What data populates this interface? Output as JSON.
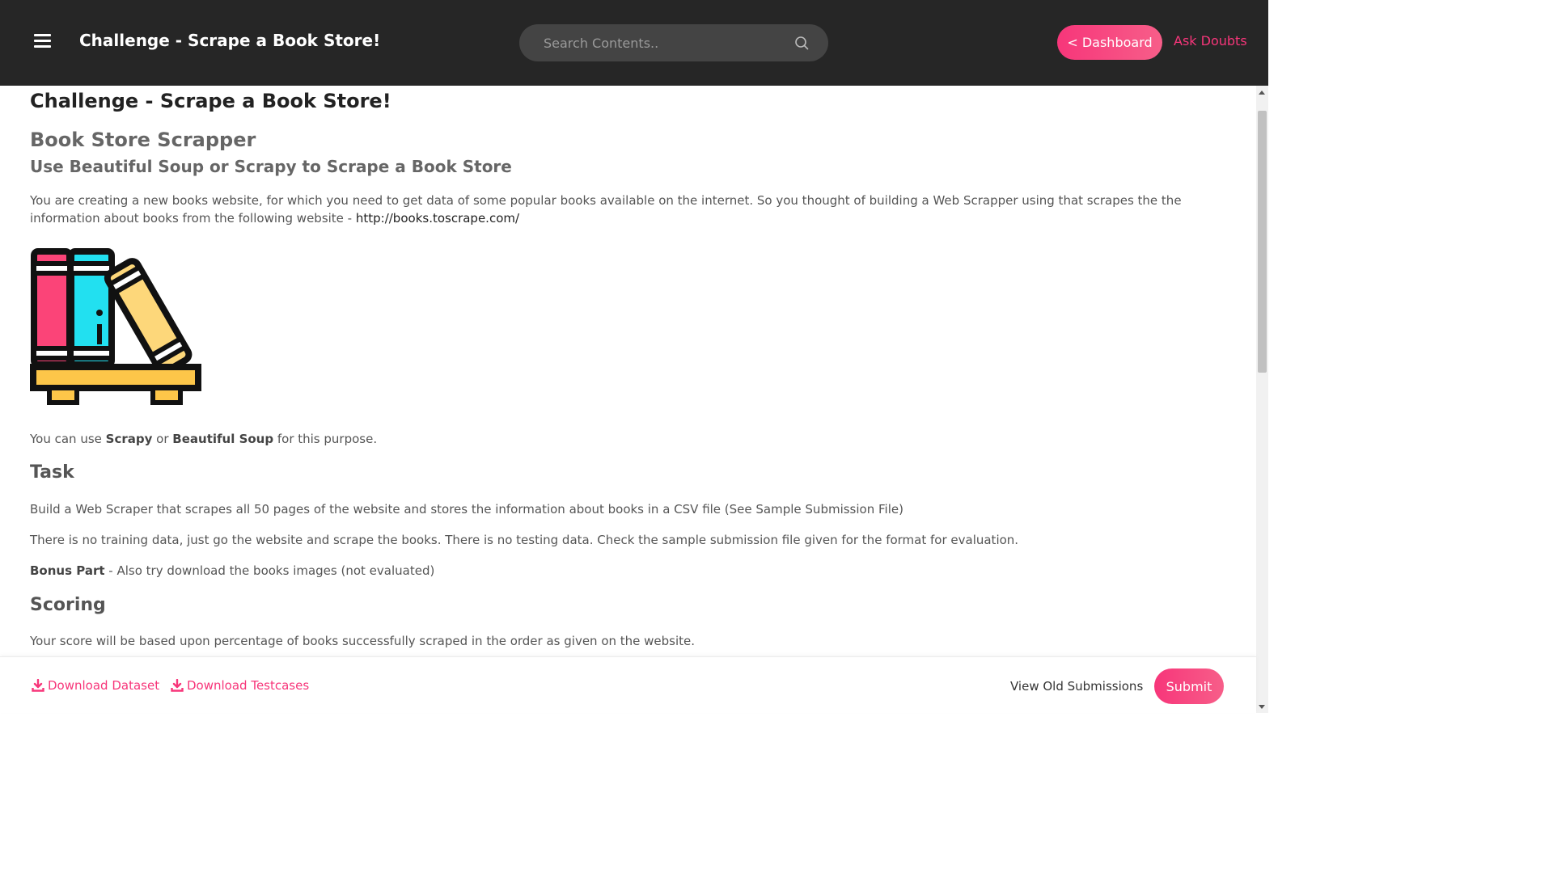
{
  "header": {
    "title": "Challenge - Scrape a Book Store!",
    "search_placeholder": "Search Contents..",
    "dashboard_label": "< Dashboard",
    "ask_doubts_label": "Ask Doubts"
  },
  "content": {
    "page_title": "Challenge - Scrape a Book Store!",
    "heading": "Book Store Scrapper",
    "subheading": "Use Beautiful Soup or Scrapy to Scrape a Book Store",
    "intro_text": "You are creating a new books website, for which you need to get data of some popular books available on the internet. So you thought of building a Web Scrapper using that scrapes the the information about books from the following website - ",
    "intro_link": "http://books.toscrape.com/",
    "tools_prefix": "You can use ",
    "tools_scrapy": "Scrapy",
    "tools_or": " or ",
    "tools_bs": "Beautiful Soup",
    "tools_suffix": " for this purpose.",
    "task_heading": "Task",
    "task_text_1": "Build a Web Scraper that scrapes all 50 pages of the website and stores the information about books in a CSV file (See Sample Submission File)",
    "task_text_2": "There is no training data, just go the website and scrape the books. There is no testing data. Check the sample submission file given for the format for evaluation.",
    "bonus_label": "Bonus Part",
    "bonus_text": " - Also try download the books images (not evaluated)",
    "scoring_heading": "Scoring",
    "scoring_text": "Your score will be based upon percentage of books successfully scraped in the order as given on the website."
  },
  "footer": {
    "download_dataset": "Download Dataset",
    "download_testcases": "Download Testcases",
    "view_old_submissions": "View Old Submissions",
    "submit_label": "Submit"
  },
  "icons": [
    "menu-icon",
    "search-icon",
    "download-icon",
    "bookshelf-illustration"
  ],
  "colors": {
    "accent": "#f7367a",
    "topbar": "#262626",
    "search_bg": "#444444"
  }
}
